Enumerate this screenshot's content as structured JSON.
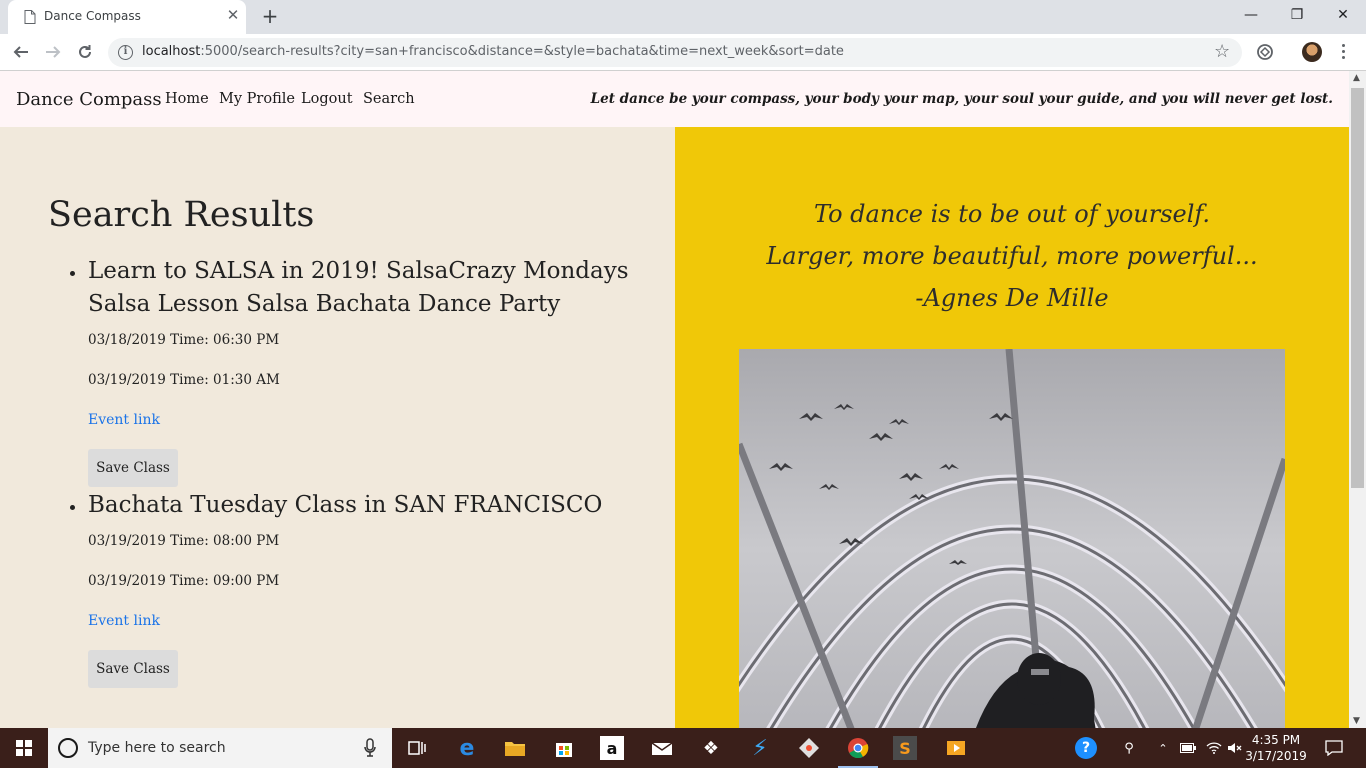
{
  "browser": {
    "tab_title": "Dance Compass",
    "url_host": "localhost",
    "url_rest": ":5000/search-results?city=san+francisco&distance=&style=bachata&time=next_week&sort=date"
  },
  "site_nav": {
    "brand": "Dance Compass",
    "links": [
      "Home",
      "My Profile",
      "Logout",
      "Search"
    ],
    "tagline": "Let dance be your compass, your body your map, your soul your guide, and you will never get lost."
  },
  "main": {
    "title": "Search Results",
    "results": [
      {
        "title": "Learn to SALSA in 2019! SalsaCrazy Mondays Salsa Lesson Salsa Bachata Dance Party",
        "start": "03/18/2019 Time: 06:30 PM",
        "end": "03/19/2019 Time: 01:30 AM",
        "link_label": "Event link",
        "save_label": "Save Class"
      },
      {
        "title": "Bachata Tuesday Class in SAN FRANCISCO",
        "start": "03/19/2019 Time: 08:00 PM",
        "end": "03/19/2019 Time: 09:00 PM",
        "link_label": "Event link",
        "save_label": "Save Class"
      }
    ]
  },
  "quote": {
    "line1": "To dance is to be out of yourself.",
    "line2": "Larger, more beautiful, more powerful...",
    "author": "-Agnes De Mille"
  },
  "taskbar": {
    "search_placeholder": "Type here to search",
    "time": "4:35 PM",
    "date": "3/17/2019"
  },
  "colors": {
    "nav_bg": "#fff5f7",
    "left_bg": "#f1e9dc",
    "right_bg": "#f0c808",
    "link": "#1a73e8"
  }
}
